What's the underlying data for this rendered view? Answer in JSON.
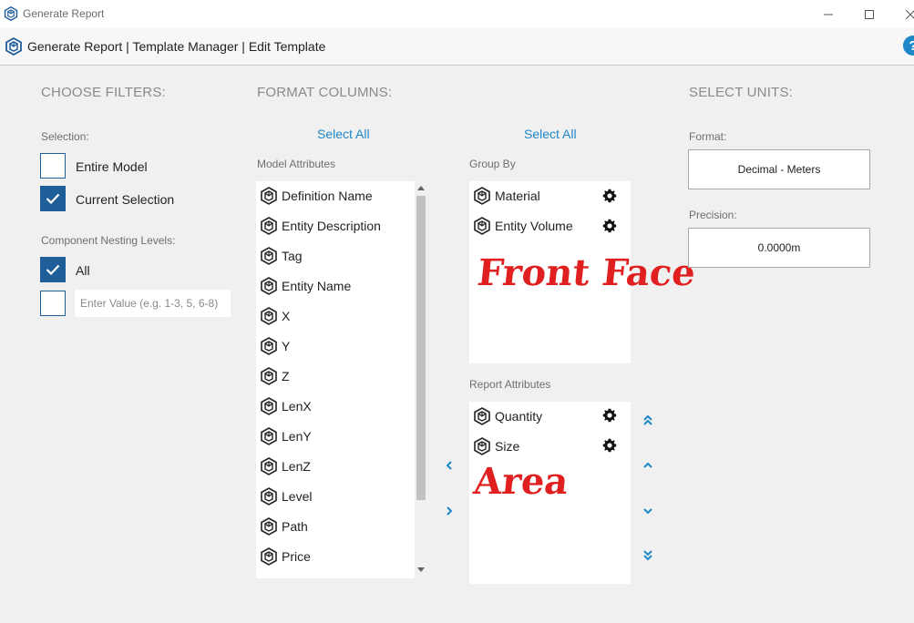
{
  "window": {
    "title": "Generate Report"
  },
  "header": {
    "breadcrumb": "Generate Report | Template Manager | Edit Template",
    "help": "?"
  },
  "filters": {
    "heading": "CHOOSE FILTERS:",
    "selection_label": "Selection:",
    "options": [
      {
        "label": "Entire Model",
        "checked": false
      },
      {
        "label": "Current Selection",
        "checked": true
      }
    ],
    "nesting_label": "Component Nesting Levels:",
    "nesting_all": {
      "label": "All",
      "checked": true
    },
    "nesting_custom": {
      "checked": false,
      "placeholder": "Enter Value (e.g. 1-3, 5, 6-8)"
    }
  },
  "format": {
    "heading": "FORMAT COLUMNS:",
    "select_all_left": "Select All",
    "select_all_right": "Select All",
    "model_attributes_label": "Model Attributes",
    "model_attributes": [
      "Definition Name",
      "Entity Description",
      "Tag",
      "Entity Name",
      "X",
      "Y",
      "Z",
      "LenX",
      "LenY",
      "LenZ",
      "Level",
      "Path",
      "Price"
    ],
    "group_by_label": "Group By",
    "group_by": [
      "Material",
      "Entity Volume"
    ],
    "report_attributes_label": "Report Attributes",
    "report_attributes": [
      "Quantity",
      "Size"
    ]
  },
  "annotations": {
    "front_face": "Front Face",
    "area": "Area"
  },
  "units": {
    "heading": "SELECT UNITS:",
    "format_label": "Format:",
    "format_value": "Decimal - Meters",
    "precision_label": "Precision:",
    "precision_value": "0.0000m"
  },
  "colors": {
    "accent": "#1e88c7",
    "checkbox": "#1f5f99",
    "annotation": "#e02020"
  },
  "icons": {
    "sketchup_logo": "sketchup-logo-icon",
    "gear": "gear-icon",
    "move_left": "chevron-left-icon",
    "move_right": "chevron-right-icon",
    "move_top": "double-chevron-up-icon",
    "move_up": "chevron-up-icon",
    "move_down": "chevron-down-icon",
    "move_bottom": "double-chevron-down-icon"
  }
}
